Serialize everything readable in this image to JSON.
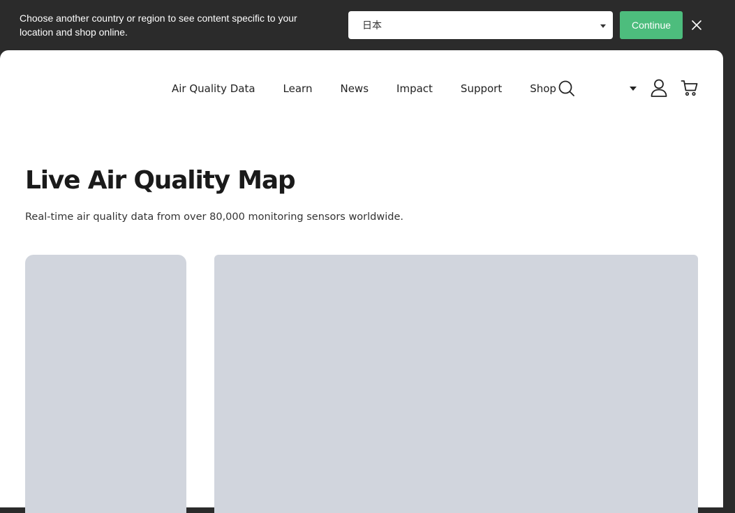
{
  "region_banner": {
    "message": "Choose another country or region to see content specific to your location and shop online.",
    "selected_region": "日本",
    "continue_label": "Continue"
  },
  "header": {
    "nav": [
      {
        "label": "Air Quality Data"
      },
      {
        "label": "Learn"
      },
      {
        "label": "News"
      },
      {
        "label": "Impact"
      },
      {
        "label": "Support"
      },
      {
        "label": "Shop"
      }
    ]
  },
  "hero": {
    "title": "Live Air Quality Map",
    "subtitle": "Real-time air quality data from over 80,000 monitoring sensors worldwide."
  },
  "colors": {
    "banner_bg": "#2b2b2b",
    "accent_green": "#4dbd7d",
    "skeleton": "#d1d5dd"
  },
  "icons": {
    "search": "search-icon",
    "account": "account-icon",
    "cart": "cart-icon",
    "close": "close-icon"
  }
}
